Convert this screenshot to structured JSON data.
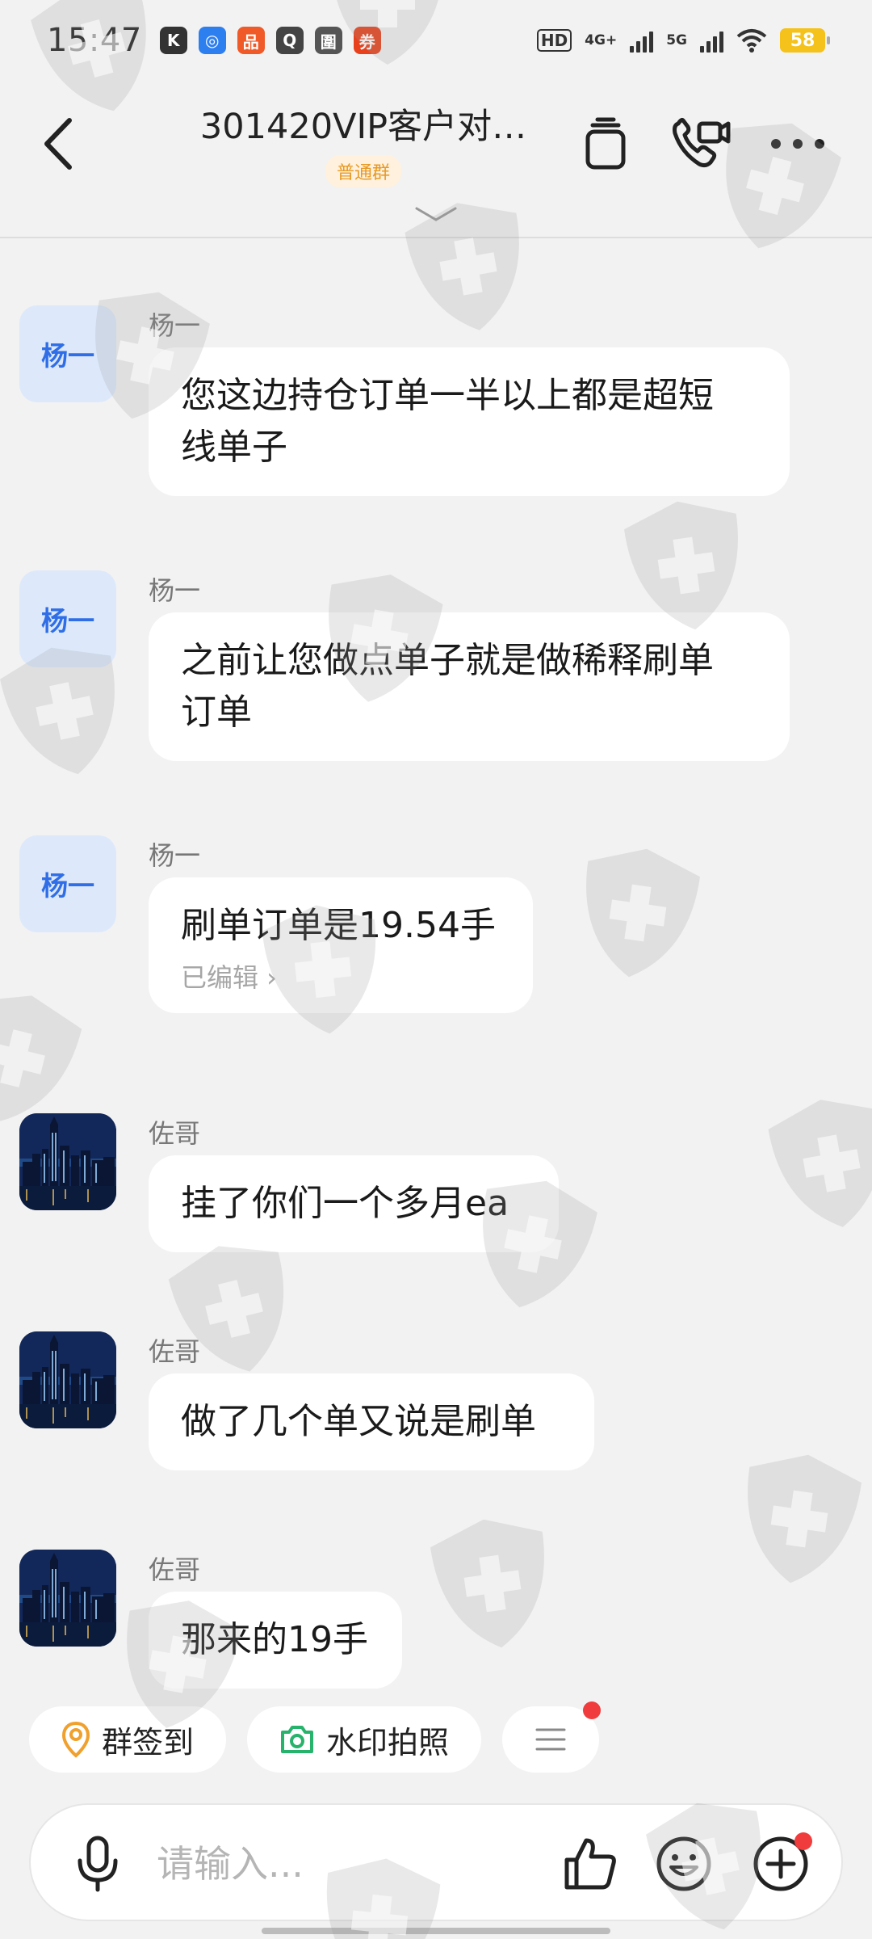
{
  "status_bar": {
    "time": "15:47",
    "app_icons": [
      {
        "icon": "k-app-icon",
        "glyph": "K",
        "color": "#333333"
      },
      {
        "icon": "wifi-app-icon",
        "glyph": "◎",
        "color": "#2d7ff0"
      },
      {
        "icon": "shop-app-icon",
        "glyph": "品",
        "color": "#f05a28"
      },
      {
        "icon": "search-app-icon",
        "glyph": "Q",
        "color": "#444444"
      },
      {
        "icon": "doc-app-icon",
        "glyph": "圍",
        "color": "#555555"
      },
      {
        "icon": "red-app-icon",
        "glyph": "券",
        "color": "#e8401c"
      }
    ],
    "hd_label": "HD",
    "net_4g": "4G+",
    "net_5g": "5G",
    "battery": "58"
  },
  "header": {
    "title": "301420VIP客户对…",
    "group_tag": "普通群",
    "icons": [
      "back-icon",
      "copy-icon",
      "video-call-icon",
      "more-icon",
      "expand-chevron-icon"
    ]
  },
  "messages": [
    {
      "sender": "杨一",
      "avatar_text": "杨一",
      "avatar_type": "text",
      "lines": [
        "您这边持仓订单一半以上都是超短",
        "线单子"
      ]
    },
    {
      "sender": "杨一",
      "avatar_text": "杨一",
      "avatar_type": "text",
      "lines": [
        "之前让您做点单子就是做稀释刷单",
        "订单"
      ]
    },
    {
      "sender": "杨一",
      "avatar_text": "杨一",
      "avatar_type": "text",
      "lines": [
        "刷单订单是19.54手"
      ],
      "edited_label": "已编辑 ›"
    },
    {
      "sender": "佐哥",
      "avatar_type": "image",
      "lines": [
        "挂了你们一个多月ea"
      ]
    },
    {
      "sender": "佐哥",
      "avatar_type": "image",
      "lines": [
        "做了几个单又说是刷单"
      ]
    },
    {
      "sender": "佐哥",
      "avatar_type": "image",
      "lines": [
        "那来的19手"
      ]
    }
  ],
  "quick_actions": {
    "checkin_label": "群签到",
    "watermark_photo_label": "水印拍照",
    "menu_icon": "menu-icon"
  },
  "input": {
    "placeholder": "请输入...",
    "value": "",
    "icons": [
      "microphone-icon",
      "thumbs-up-icon",
      "emoji-icon",
      "plus-icon"
    ]
  },
  "colors": {
    "background": "#f2f2f2",
    "bubble": "#ffffff",
    "avatar_bg": "#dde9fb",
    "avatar_text": "#2f6ee6",
    "tag_text": "#e79a25",
    "badge_red": "#f03c3c",
    "checkin_icon": "#f0a02c",
    "camera_icon": "#27b36c"
  }
}
